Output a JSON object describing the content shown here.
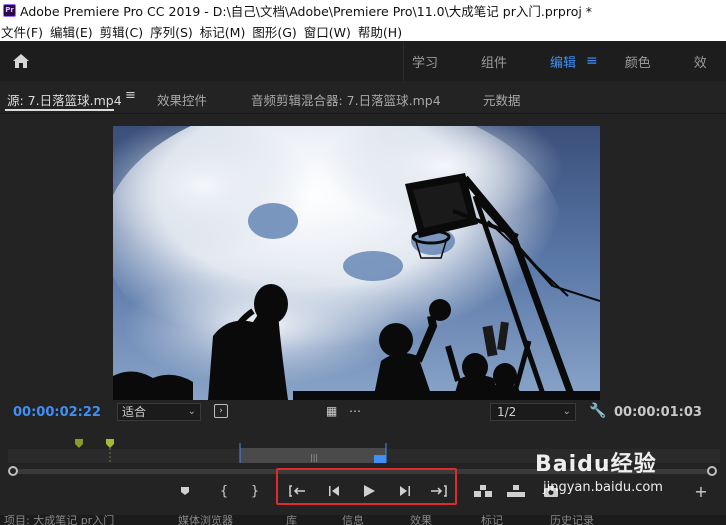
{
  "window": {
    "title": "Adobe Premiere Pro CC 2019 - D:\\自己\\文档\\Adobe\\Premiere Pro\\11.0\\大成笔记 pr入门.prproj *",
    "app_icon_text": "Pr"
  },
  "menu": {
    "items": [
      "文件(F)",
      "编辑(E)",
      "剪辑(C)",
      "序列(S)",
      "标记(M)",
      "图形(G)",
      "窗口(W)",
      "帮助(H)"
    ]
  },
  "workspaces": {
    "tabs": [
      "学习",
      "组件",
      "编辑",
      "颜色",
      "效"
    ],
    "active": "编辑",
    "accent_color": "#3f8ff5"
  },
  "panel": {
    "tabs": [
      "源: 7.日落篮球.mp4",
      "效果控件",
      "音频剪辑混合器: 7.日落篮球.mp4",
      "元数据"
    ],
    "active_tab": "源: 7.日落篮球.mp4"
  },
  "source_monitor": {
    "current_timecode": "00:00:02:22",
    "fit_option": "适合",
    "resolution": "1/2",
    "duration_timecode": "00:00:01:03"
  },
  "bottom_strip": {
    "labels": [
      "项目: 大成笔记 pr入门",
      "媒体浏览器",
      "库",
      "信息",
      "效果",
      "标记",
      "历史记录"
    ]
  },
  "watermark": {
    "brand": "Baidu经验",
    "url": "jingyan.baidu.com"
  },
  "highlight_color": "#e12a2a"
}
